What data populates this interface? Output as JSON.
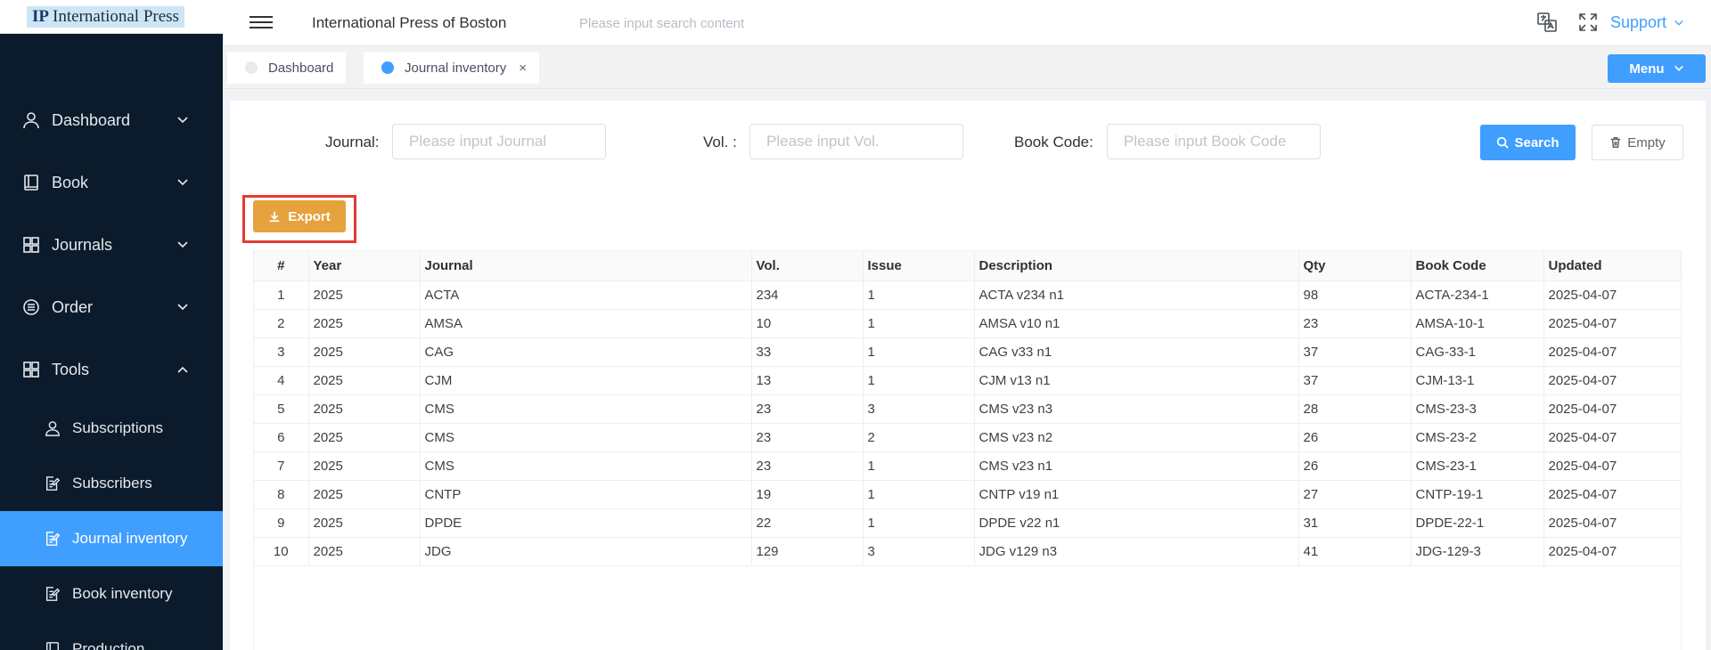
{
  "logo": {
    "text": "International Press"
  },
  "sidebar": {
    "items": [
      {
        "label": "Dashboard",
        "icon": "user-icon",
        "expanded": false
      },
      {
        "label": "Book",
        "icon": "book-icon",
        "expanded": false
      },
      {
        "label": "Journals",
        "icon": "grid-icon",
        "expanded": false
      },
      {
        "label": "Order",
        "icon": "list-circle-icon",
        "expanded": false
      },
      {
        "label": "Tools",
        "icon": "grid-icon",
        "expanded": true
      }
    ],
    "subitems": [
      {
        "label": "Subscriptions",
        "icon": "user-outline-icon",
        "active": false
      },
      {
        "label": "Subscribers",
        "icon": "edit-doc-icon",
        "active": false
      },
      {
        "label": "Journal inventory",
        "icon": "edit-doc-icon",
        "active": true
      },
      {
        "label": "Book inventory",
        "icon": "edit-doc-icon",
        "active": false
      },
      {
        "label": "Production",
        "icon": "book-icon",
        "active": false
      }
    ]
  },
  "header": {
    "title": "International Press of Boston",
    "search_placeholder": "Please input search content",
    "support_label": "Support"
  },
  "tabs": [
    {
      "label": "Dashboard",
      "active": false
    },
    {
      "label": "Journal inventory",
      "active": true,
      "close": "×"
    }
  ],
  "menu_button": {
    "label": "Menu"
  },
  "filters": {
    "journal_label": "Journal:",
    "journal_placeholder": "Please input Journal",
    "vol_label": "Vol. :",
    "vol_placeholder": "Please input Vol.",
    "bookcode_label": "Book Code:",
    "bookcode_placeholder": "Please input Book Code",
    "search_label": "Search",
    "empty_label": "Empty"
  },
  "export": {
    "label": "Export"
  },
  "table": {
    "headers": [
      "#",
      "Year",
      "Journal",
      "Vol.",
      "Issue",
      "Description",
      "Qty",
      "Book Code",
      "Updated"
    ],
    "rows": [
      [
        "1",
        "2025",
        "ACTA",
        "234",
        "1",
        "ACTA v234 n1",
        "98",
        "ACTA-234-1",
        "2025-04-07"
      ],
      [
        "2",
        "2025",
        "AMSA",
        "10",
        "1",
        "AMSA v10 n1",
        "23",
        "AMSA-10-1",
        "2025-04-07"
      ],
      [
        "3",
        "2025",
        "CAG",
        "33",
        "1",
        "CAG v33 n1",
        "37",
        "CAG-33-1",
        "2025-04-07"
      ],
      [
        "4",
        "2025",
        "CJM",
        "13",
        "1",
        "CJM v13 n1",
        "37",
        "CJM-13-1",
        "2025-04-07"
      ],
      [
        "5",
        "2025",
        "CMS",
        "23",
        "3",
        "CMS v23 n3",
        "28",
        "CMS-23-3",
        "2025-04-07"
      ],
      [
        "6",
        "2025",
        "CMS",
        "23",
        "2",
        "CMS v23 n2",
        "26",
        "CMS-23-2",
        "2025-04-07"
      ],
      [
        "7",
        "2025",
        "CMS",
        "23",
        "1",
        "CMS v23 n1",
        "26",
        "CMS-23-1",
        "2025-04-07"
      ],
      [
        "8",
        "2025",
        "CNTP",
        "19",
        "1",
        "CNTP v19 n1",
        "27",
        "CNTP-19-1",
        "2025-04-07"
      ],
      [
        "9",
        "2025",
        "DPDE",
        "22",
        "1",
        "DPDE v22 n1",
        "31",
        "DPDE-22-1",
        "2025-04-07"
      ],
      [
        "10",
        "2025",
        "JDG",
        "129",
        "3",
        "JDG v129 n3",
        "41",
        "JDG-129-3",
        "2025-04-07"
      ]
    ]
  },
  "colors": {
    "sidebar_bg": "#0b1b2b",
    "accent": "#409eff",
    "export": "#e6a23c",
    "highlight": "#e53935"
  }
}
